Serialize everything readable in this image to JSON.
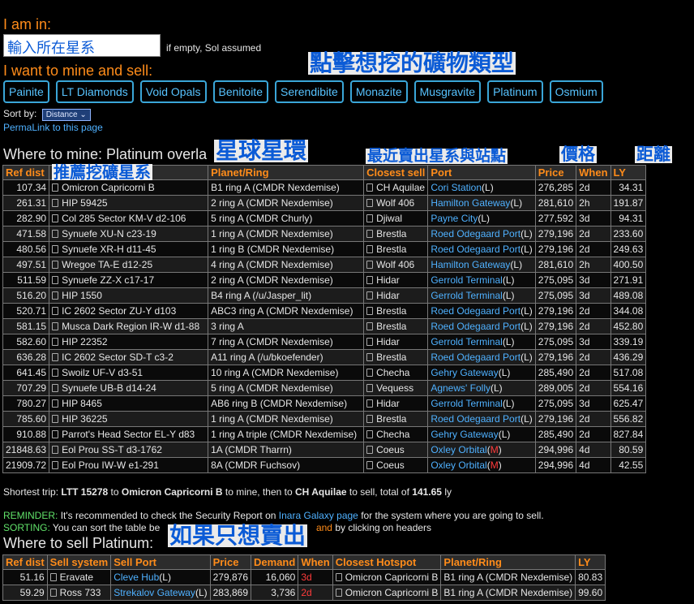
{
  "header": {
    "i_am_in": "I am in:",
    "input_value": "輸入所在星系",
    "empty_note": "if empty, Sol assumed",
    "want_to": "I want to mine and sell:",
    "sort_label": "Sort by:",
    "sort_value": "Distance",
    "permalink": "PermaLink to this page"
  },
  "materials": [
    "Painite",
    "LT Diamonds",
    "Void Opals",
    "Benitoite",
    "Serendibite",
    "Monazite",
    "Musgravite",
    "Platinum",
    "Osmium"
  ],
  "annotations": {
    "click_mineral": "點擊想挖的礦物類型",
    "planet_ring": "星球星環",
    "nearest_sell": "最近賣出星系與站點",
    "price": "價格",
    "distance": "距離",
    "recommend": "推薦挖礦星系",
    "if_only_sell": "如果只想賣出"
  },
  "mine": {
    "title": "Where to mine: Platinum overla",
    "headers": [
      "Ref dist",
      "",
      "Planet/Ring",
      "Closest sell",
      "Port",
      "Price",
      "When",
      "LY"
    ],
    "rows": [
      [
        "107.34",
        "Omicron Capricorni B",
        "B1 ring A (CMDR Nexdemise)",
        "CH Aquilae",
        "Cori Station",
        "L",
        "276,285",
        "2d",
        "34.31"
      ],
      [
        "261.31",
        "HIP 59425",
        "2 ring A (CMDR Nexdemise)",
        "Wolf 406",
        "Hamilton Gateway",
        "L",
        "281,610",
        "2h",
        "191.87"
      ],
      [
        "282.90",
        "Col 285 Sector KM-V d2-106",
        "5 ring A (CMDR Churly)",
        "Djiwal",
        "Payne City",
        "L",
        "277,592",
        "3d",
        "94.31"
      ],
      [
        "471.58",
        "Synuefe XU-N c23-19",
        "1 ring A (CMDR Nexdemise)",
        "Brestla",
        "Roed Odegaard Port",
        "L",
        "279,196",
        "2d",
        "233.60"
      ],
      [
        "480.56",
        "Synuefe XR-H d11-45",
        "1 ring B (CMDR Nexdemise)",
        "Brestla",
        "Roed Odegaard Port",
        "L",
        "279,196",
        "2d",
        "249.63"
      ],
      [
        "497.51",
        "Wregoe TA-E d12-25",
        "4 ring A (CMDR Nexdemise)",
        "Wolf 406",
        "Hamilton Gateway",
        "L",
        "281,610",
        "2h",
        "400.50"
      ],
      [
        "511.59",
        "Synuefe ZZ-X c17-17",
        "2 ring A (CMDR Nexdemise)",
        "Hidar",
        "Gerrold Terminal",
        "L",
        "275,095",
        "3d",
        "271.91"
      ],
      [
        "516.20",
        "HIP 1550",
        "B4 ring A (/u/Jasper_lit)",
        "Hidar",
        "Gerrold Terminal",
        "L",
        "275,095",
        "3d",
        "489.08"
      ],
      [
        "520.71",
        "IC 2602 Sector ZU-Y d103",
        "ABC3 ring A (CMDR Nexdemise)",
        "Brestla",
        "Roed Odegaard Port",
        "L",
        "279,196",
        "2d",
        "344.08"
      ],
      [
        "581.15",
        "Musca Dark Region IR-W d1-88",
        "3 ring A",
        "Brestla",
        "Roed Odegaard Port",
        "L",
        "279,196",
        "2d",
        "452.80"
      ],
      [
        "582.60",
        "HIP 22352",
        "7 ring A (CMDR Nexdemise)",
        "Hidar",
        "Gerrold Terminal",
        "L",
        "275,095",
        "3d",
        "339.19"
      ],
      [
        "636.28",
        "IC 2602 Sector SD-T c3-2",
        "A11 ring A (/u/bkoefender)",
        "Brestla",
        "Roed Odegaard Port",
        "L",
        "279,196",
        "2d",
        "436.29"
      ],
      [
        "641.45",
        "Swoilz UF-V d3-51",
        "10 ring A (CMDR Nexdemise)",
        "Checha",
        "Gehry Gateway",
        "L",
        "285,490",
        "2d",
        "517.08"
      ],
      [
        "707.29",
        "Synuefe UB-B d14-24",
        "5 ring A (CMDR Nexdemise)",
        "Vequess",
        "Agnews' Folly",
        "L",
        "289,005",
        "2d",
        "554.16"
      ],
      [
        "780.27",
        "HIP 8465",
        "AB6 ring B (CMDR Nexdemise)",
        "Hidar",
        "Gerrold Terminal",
        "L",
        "275,095",
        "3d",
        "625.47"
      ],
      [
        "785.60",
        "HIP 36225",
        "1 ring A (CMDR Nexdemise)",
        "Brestla",
        "Roed Odegaard Port",
        "L",
        "279,196",
        "2d",
        "556.82"
      ],
      [
        "910.88",
        "Parrot's Head Sector EL-Y d83",
        "1 ring A triple (CMDR Nexdemise)",
        "Checha",
        "Gehry Gateway",
        "L",
        "285,490",
        "2d",
        "827.84"
      ],
      [
        "21848.63",
        "Eol Prou SS-T d3-1762",
        "1A (CMDR Tharrn)",
        "Coeus",
        "Oxley Orbital",
        "M",
        "294,996",
        "4d",
        "80.59"
      ],
      [
        "21909.72",
        "Eol Prou IW-W e1-291",
        "8A (CMDR Fuchsov)",
        "Coeus",
        "Oxley Orbital",
        "M",
        "294,996",
        "4d",
        "42.55"
      ]
    ],
    "shortest_prefix": "Shortest trip:",
    "shortest_from": "LTT 15278",
    "shortest_to_word": "to",
    "shortest_mine": "Omicron Capricorni B",
    "shortest_mid": "to mine, then to",
    "shortest_sell": "CH Aquilae",
    "shortest_mid2": "to sell, total of",
    "shortest_total": "141.65",
    "shortest_unit": "ly"
  },
  "reminder": {
    "label": "REMINDER:",
    "text": "It's recommended to check the Security Report on",
    "link": "Inara Galaxy page",
    "text2": "for the system where you are going to sell."
  },
  "sorting": {
    "label": "SORTING:",
    "text": "You can sort the table be",
    "text_and": "and",
    "text2": "by clicking on headers"
  },
  "sell": {
    "title": "Where to sell Platinum:",
    "headers": [
      "Ref dist",
      "Sell system",
      "Sell Port",
      "Price",
      "Demand",
      "When",
      "Closest Hotspot",
      "Planet/Ring",
      "LY"
    ],
    "rows": [
      [
        "51.16",
        "Eravate",
        "Cleve Hub",
        "L",
        "279,876",
        "16,060",
        "3d",
        "Omicron Capricorni B",
        "B1 ring A (CMDR Nexdemise)",
        "80.83"
      ],
      [
        "59.29",
        "Ross 733",
        "Strekalov Gateway",
        "L",
        "283,869",
        "3,736",
        "2d",
        "Omicron Capricorni B",
        "B1 ring A (CMDR Nexdemise)",
        "99.60"
      ]
    ]
  }
}
